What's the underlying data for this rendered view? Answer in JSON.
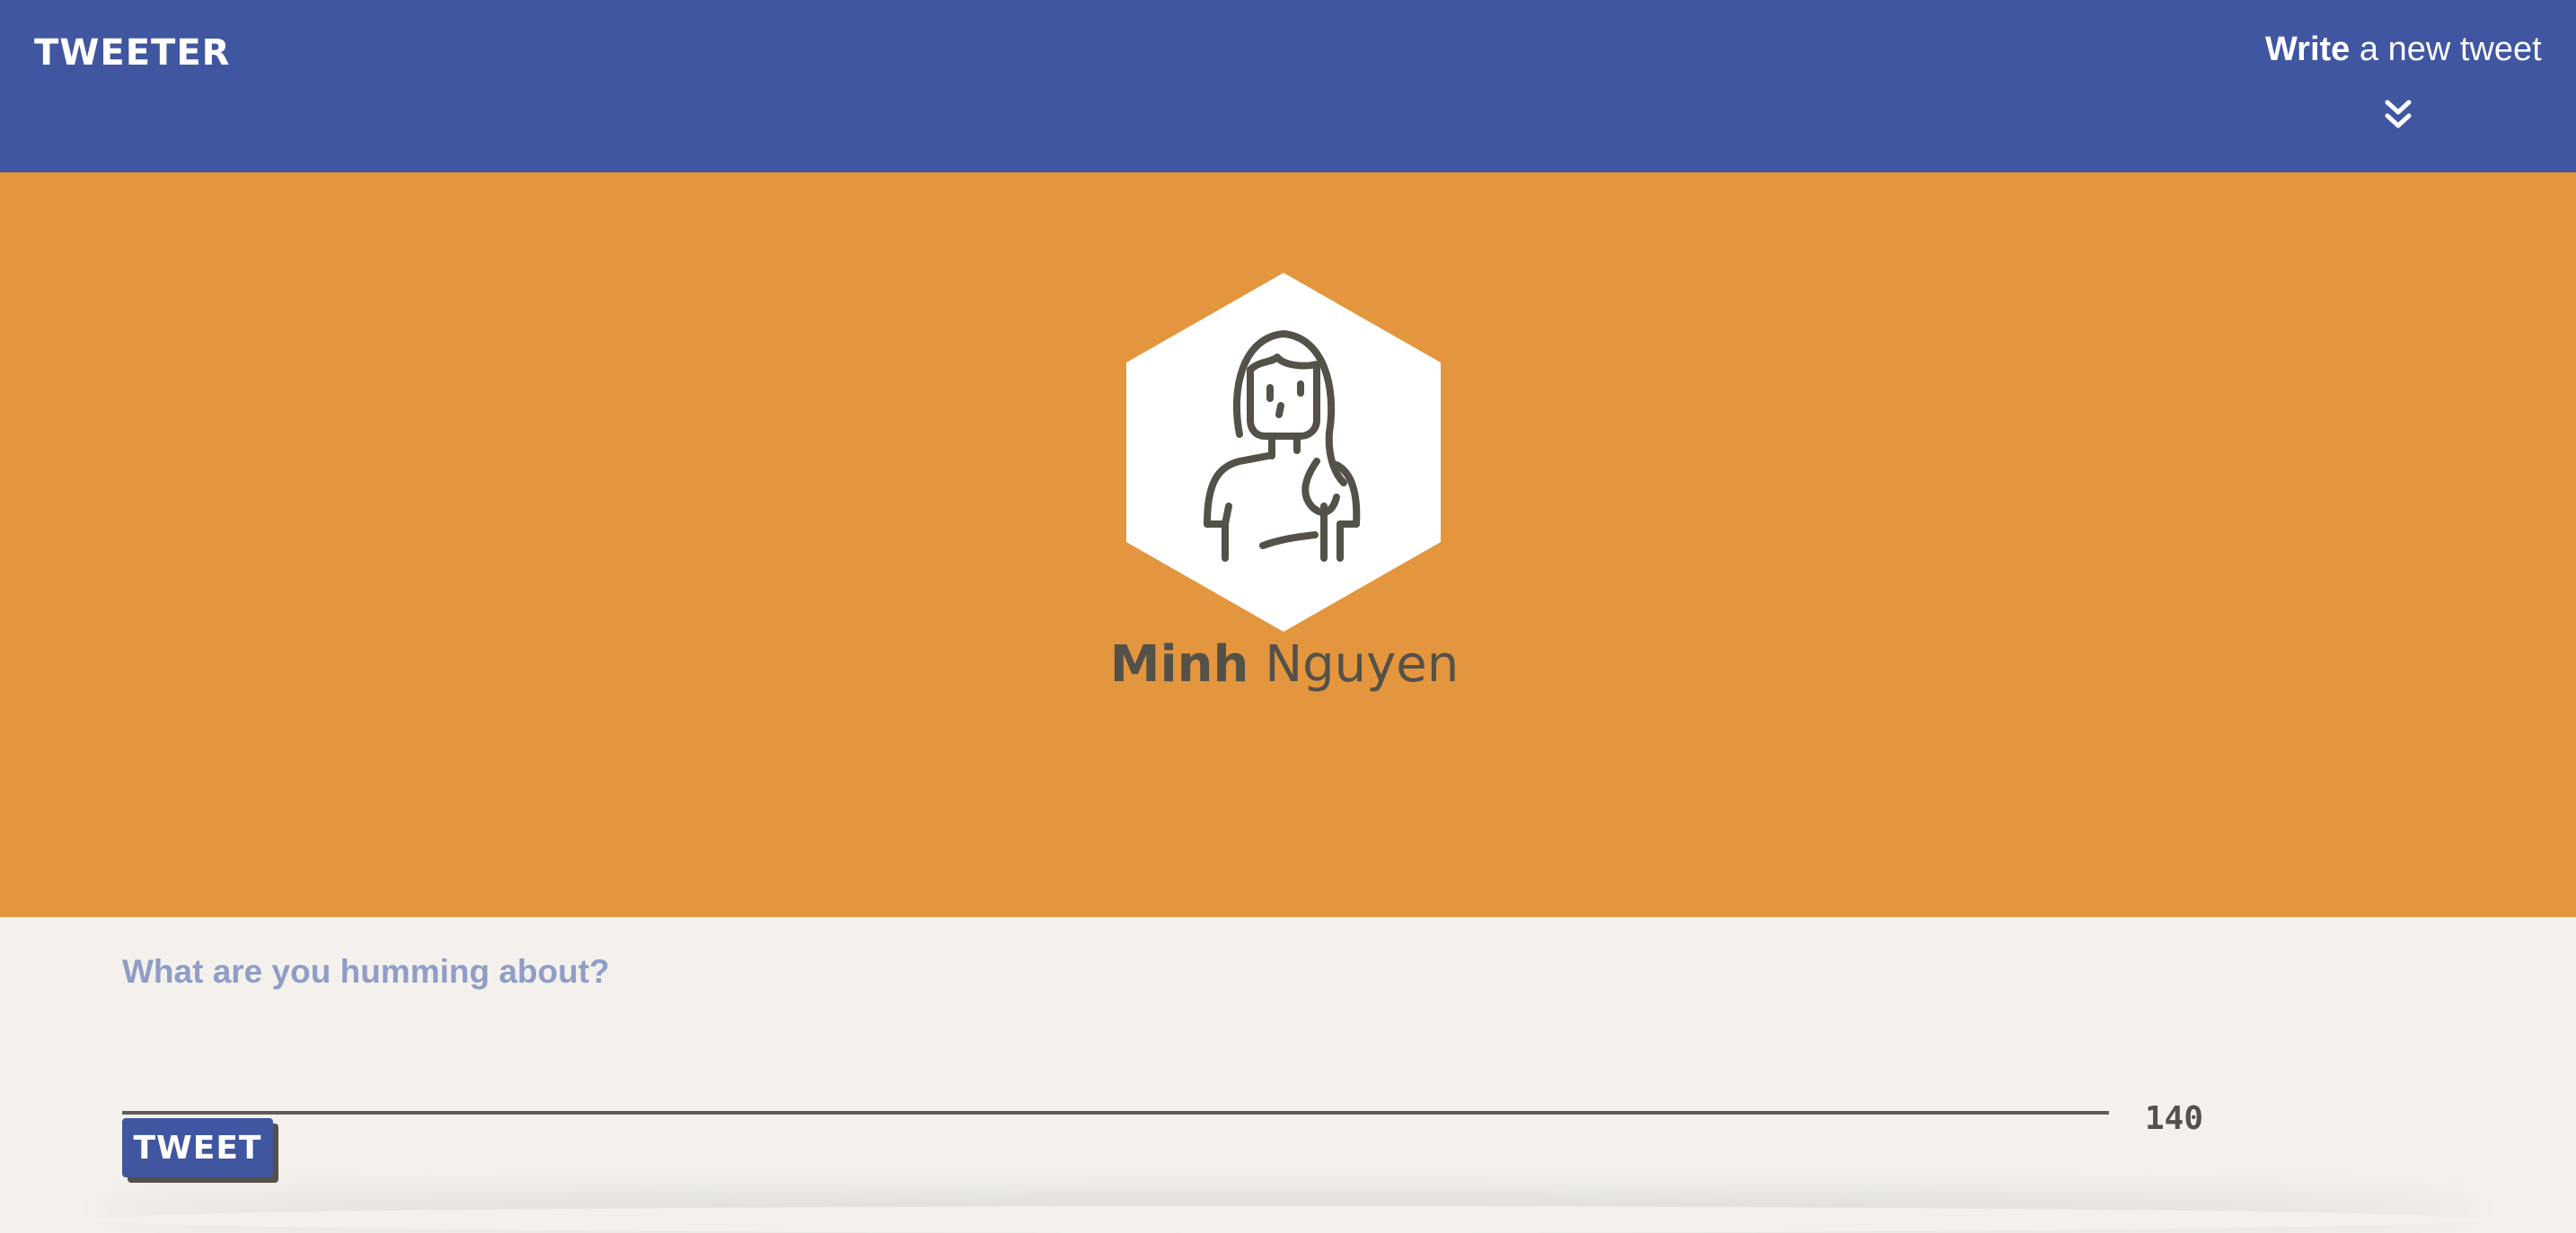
{
  "nav": {
    "brand": "TWEETER",
    "compose_toggle": {
      "bold": "Write",
      "rest": " a new tweet",
      "icon": "double-chevron-down-icon"
    },
    "background_color": "#4056a1"
  },
  "profile": {
    "avatar_icon": "user-avatar-icon",
    "first_name": "Minh",
    "last_name": "Nguyen",
    "background_color": "#e3963e"
  },
  "compose": {
    "placeholder": "What are you humming about?",
    "value": "",
    "submit_label": "TWEET",
    "char_counter": "140",
    "background_color": "#f4f1ec"
  }
}
